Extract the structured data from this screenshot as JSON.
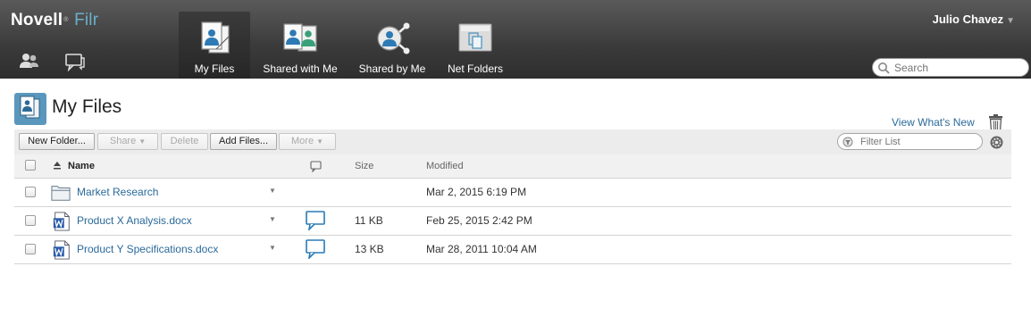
{
  "header": {
    "brand": "Novell",
    "brand_mark": "®",
    "product": "Filr",
    "user_name": "Julio Chavez",
    "user_menu_icon": "chevron-down-icon",
    "search_placeholder": "Search",
    "people_icon": "people-icon",
    "comments_icon": "comments-icon",
    "tabs": [
      {
        "label": "My Files",
        "icon": "my-files-icon",
        "active": true
      },
      {
        "label": "Shared with Me",
        "icon": "shared-with-me-icon",
        "active": false
      },
      {
        "label": "Shared by Me",
        "icon": "shared-by-me-icon",
        "active": false
      },
      {
        "label": "Net Folders",
        "icon": "net-folders-icon",
        "active": false
      }
    ]
  },
  "page": {
    "title": "My Files",
    "whats_new": "View What's New",
    "trash_icon": "trash-icon"
  },
  "toolbar": {
    "new_folder": "New Folder...",
    "share": "Share",
    "delete": "Delete",
    "add_files": "Add Files...",
    "more": "More",
    "filter_placeholder": "Filter List"
  },
  "table": {
    "columns": {
      "name": "Name",
      "size": "Size",
      "modified": "Modified"
    },
    "sort_icon": "sort-asc-icon",
    "comment_header_icon": "comment-icon",
    "rows": [
      {
        "type": "folder",
        "name": "Market Research",
        "size": "",
        "modified": "Mar 2, 2015 6:19 PM",
        "has_comments": false
      },
      {
        "type": "docx",
        "name": "Product X Analysis.docx",
        "size": "11 KB",
        "modified": "Feb 25, 2015 2:42 PM",
        "has_comments": true
      },
      {
        "type": "docx",
        "name": "Product Y Specifications.docx",
        "size": "13 KB",
        "modified": "Mar 28, 2011 10:04 AM",
        "has_comments": true
      }
    ]
  }
}
